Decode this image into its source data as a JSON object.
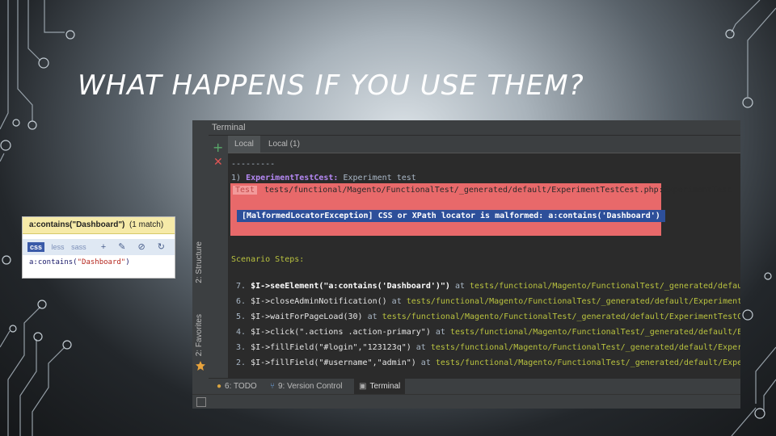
{
  "slide": {
    "title": "WHAT HAPPENS IF YOU USE THEM?"
  },
  "css_box": {
    "header_query": "a:contains(\"Dashboard\")",
    "header_matches": "(1 match)",
    "tabs": [
      "css",
      "less",
      "sass"
    ],
    "tool_icons": [
      "plus-icon",
      "pin-icon",
      "block-icon",
      "refresh-icon"
    ],
    "tool_glyphs": [
      "+",
      "✎",
      "⊘",
      "↻"
    ],
    "expr_prefix": "a:contains(",
    "expr_string": "\"Dashboard\"",
    "expr_suffix": ")"
  },
  "ide": {
    "panel_title": "Terminal",
    "tabs": [
      "Local",
      "Local (1)"
    ],
    "side_tabs": [
      "2: Structure",
      "2: Favorites"
    ],
    "separator": "---------",
    "test_line_prefix": "1) ",
    "test_name": "ExperimentTestCest:",
    "test_desc": " Experiment test",
    "error": {
      "badge": "Test",
      "path": "tests/functional/Magento/FunctionalTest/_generated/default/ExperimentTestCest.php:ExperimentTest",
      "message": "[MalformedLocatorException] CSS or XPath locator is malformed: a:contains('Dashboard')"
    },
    "scenario_label": "Scenario Steps:",
    "steps": [
      {
        "num": "7.",
        "cmd": "$I->seeElement(\"a:contains('Dashboard')\")",
        "at": " at ",
        "path": "tests/functional/Magento/FunctionalTest/_generated/defaul",
        "bold": true
      },
      {
        "num": "6.",
        "cmd": "$I->closeAdminNotification()",
        "at": " at ",
        "path": "tests/functional/Magento/FunctionalTest/_generated/default/ExperimentT",
        "bold": false
      },
      {
        "num": "5.",
        "cmd": "$I->waitForPageLoad(30)",
        "at": " at ",
        "path": "tests/functional/Magento/FunctionalTest/_generated/default/ExperimentTestCe",
        "bold": false
      },
      {
        "num": "4.",
        "cmd": "$I->click(\".actions .action-primary\")",
        "at": " at ",
        "path": "tests/functional/Magento/FunctionalTest/_generated/default/Ex",
        "bold": false
      },
      {
        "num": "3.",
        "cmd": "$I->fillField(\"#login\",\"123123q\")",
        "at": " at ",
        "path": "tests/functional/Magento/FunctionalTest/_generated/default/Experi",
        "bold": false
      },
      {
        "num": "2.",
        "cmd": "$I->fillField(\"#username\",\"admin\")",
        "at": " at ",
        "path": "tests/functional/Magento/FunctionalTest/_generated/default/Exper",
        "bold": false
      }
    ],
    "bottom_tabs": [
      {
        "label": "6: TODO",
        "icon": "todo-icon"
      },
      {
        "label": "9: Version Control",
        "icon": "version-control-icon"
      },
      {
        "label": "Terminal",
        "icon": "terminal-icon"
      }
    ],
    "colors": {
      "error_bg": "#e8696a",
      "message_bg": "#2d4f9a",
      "path": "#b9c23f",
      "test_name": "#b588f3"
    }
  }
}
